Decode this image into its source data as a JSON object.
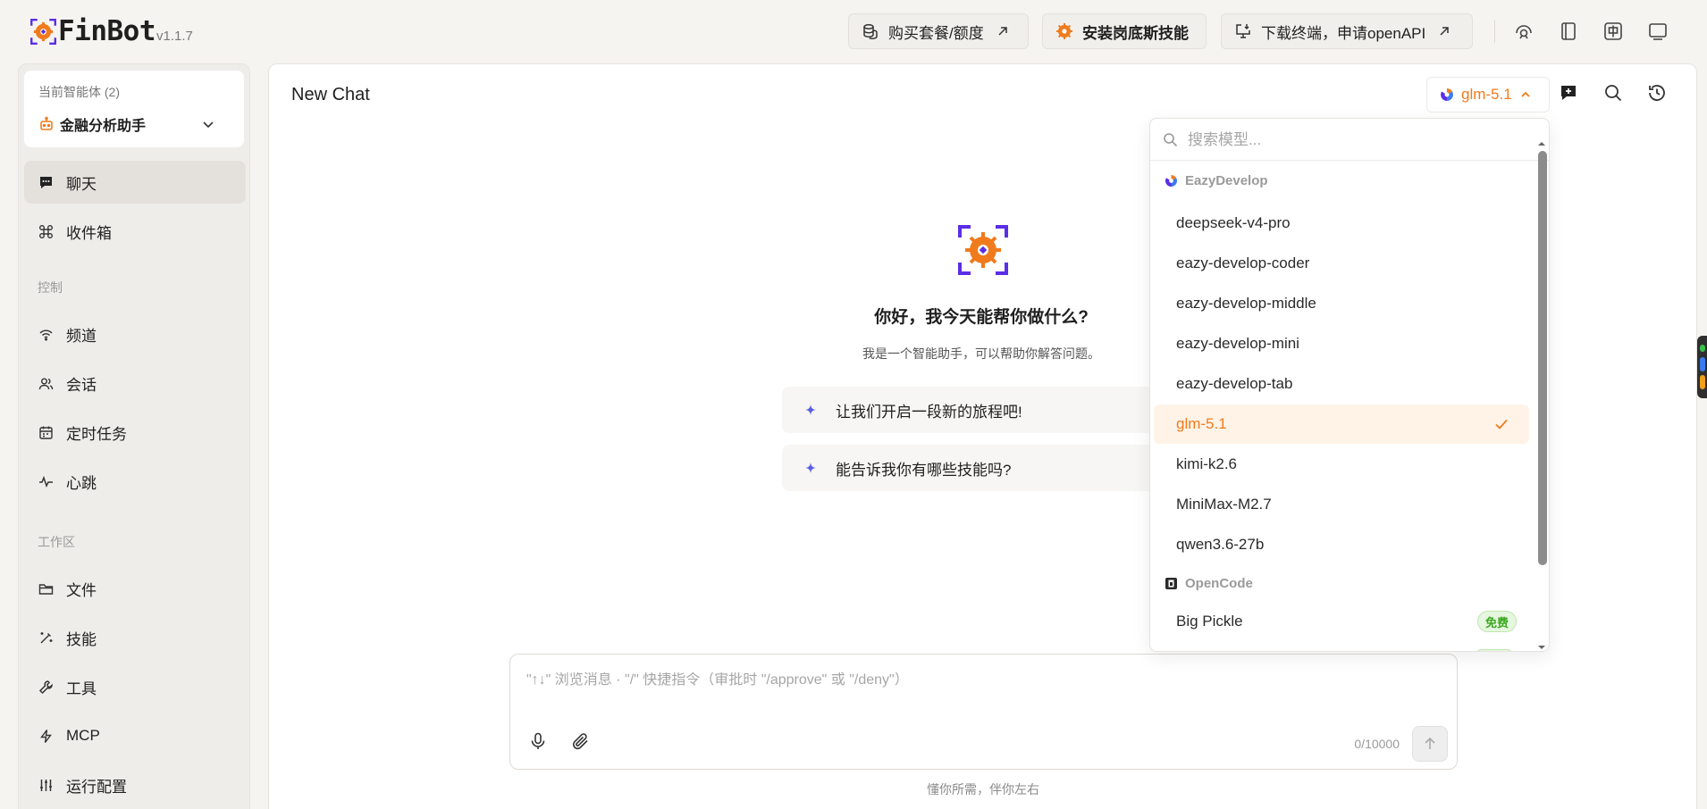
{
  "app": {
    "name": "FinBot",
    "version": "v1.1.7"
  },
  "topbar": {
    "buy_label": "购买套餐/额度",
    "install_label": "安装岗底斯技能",
    "download_label": "下载终端，申请openAPI",
    "icons": [
      "assistant-icon",
      "book-icon",
      "language-zh-icon",
      "window-icon"
    ]
  },
  "sidebar": {
    "agent_label": "当前智能体 (2)",
    "agent_name": "金融分析助手",
    "items_top": [
      {
        "label": "聊天",
        "icon": "chat-icon",
        "active": true
      },
      {
        "label": "收件箱",
        "icon": "inbox-icon",
        "active": false
      }
    ],
    "section_control": "控制",
    "items_control": [
      {
        "label": "频道",
        "icon": "wifi-icon"
      },
      {
        "label": "会话",
        "icon": "users-icon"
      },
      {
        "label": "定时任务",
        "icon": "calendar-icon"
      },
      {
        "label": "心跳",
        "icon": "pulse-icon"
      }
    ],
    "section_workspace": "工作区",
    "items_workspace": [
      {
        "label": "文件",
        "icon": "folder-icon"
      },
      {
        "label": "技能",
        "icon": "magic-wand-icon"
      },
      {
        "label": "工具",
        "icon": "wrench-icon"
      },
      {
        "label": "MCP",
        "icon": "lightning-icon"
      },
      {
        "label": "运行配置",
        "icon": "sliders-icon"
      }
    ]
  },
  "chat": {
    "title": "New Chat",
    "current_model": "glm-5.1",
    "welcome_title": "你好，我今天能帮你做什么?",
    "welcome_subtitle": "我是一个智能助手，可以帮助你解答问题。",
    "suggestions": [
      "让我们开启一段新的旅程吧!",
      "能告诉我你有哪些技能吗?"
    ],
    "input_placeholder": "\"↑↓\" 浏览消息 · \"/\" 快捷指令（审批时 \"/approve\" 或 \"/deny\"）",
    "counter": "0/10000",
    "footer_note": "懂你所需，伴你左右"
  },
  "model_dropdown": {
    "search_placeholder": "搜索模型...",
    "groups": [
      {
        "name": "EazyDevelop",
        "models": [
          {
            "name": "deepseek-v4-pro"
          },
          {
            "name": "eazy-develop-coder"
          },
          {
            "name": "eazy-develop-middle"
          },
          {
            "name": "eazy-develop-mini"
          },
          {
            "name": "eazy-develop-tab"
          },
          {
            "name": "glm-5.1",
            "selected": true
          },
          {
            "name": "kimi-k2.6"
          },
          {
            "name": "MiniMax-M2.7"
          },
          {
            "name": "qwen3.6-27b"
          }
        ]
      },
      {
        "name": "OpenCode",
        "models": [
          {
            "name": "Big Pickle",
            "badge": "免费"
          }
        ]
      }
    ]
  },
  "colors": {
    "accent": "#f07b1d",
    "brand_purple": "#5a2ee6",
    "badge_green": "#3aa81f"
  }
}
